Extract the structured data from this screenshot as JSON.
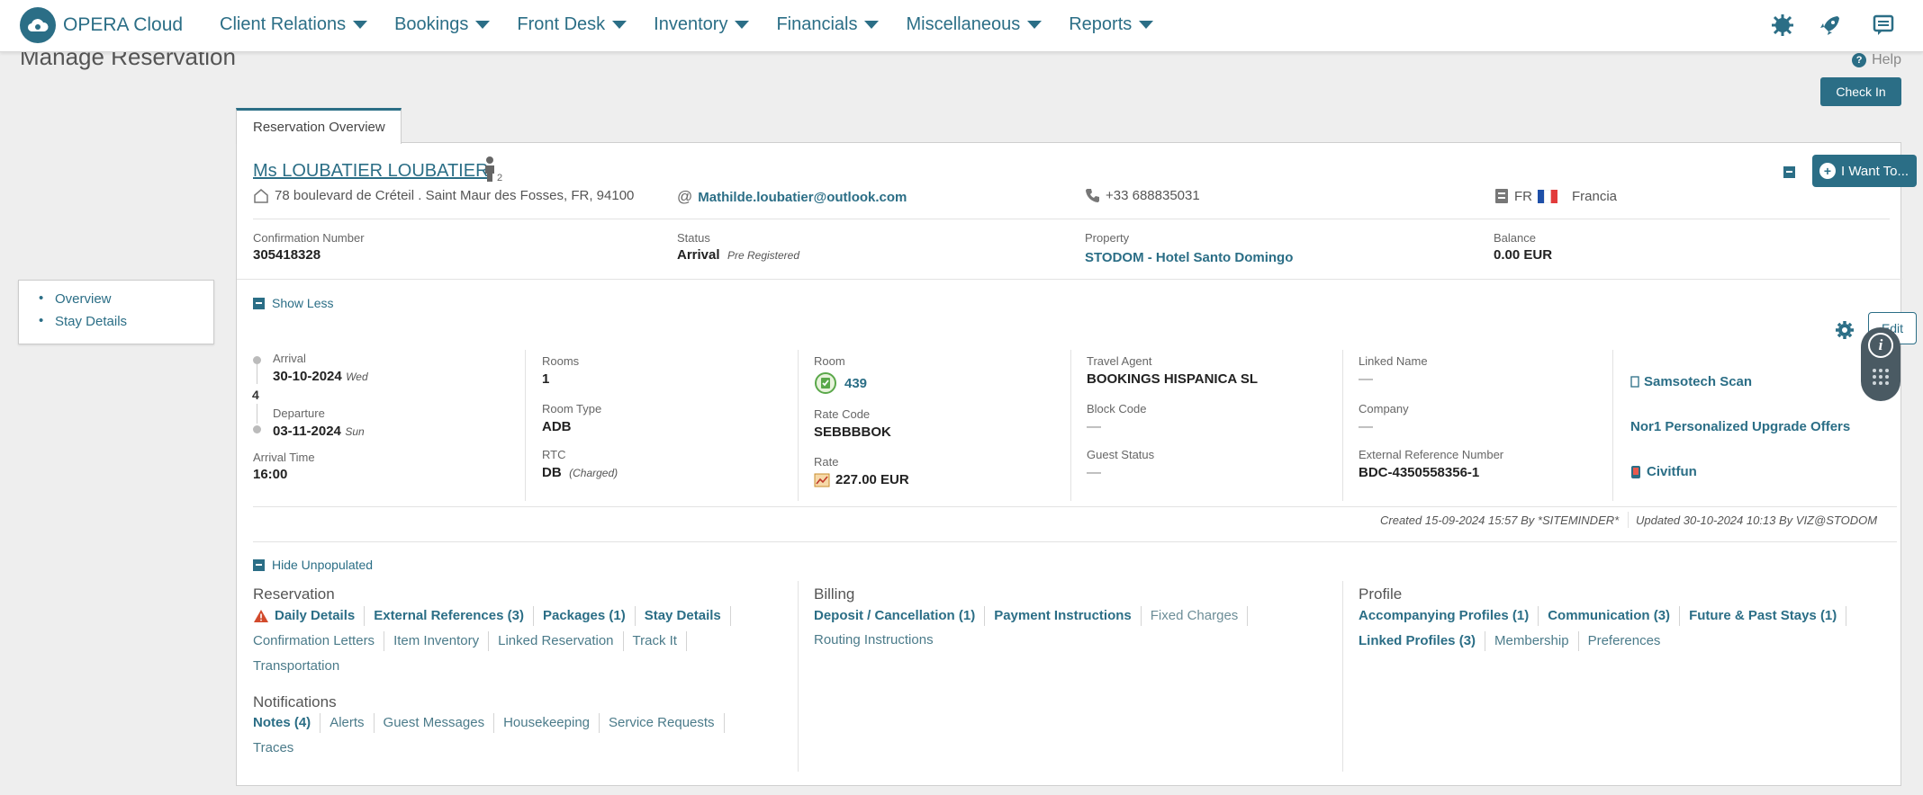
{
  "app": {
    "name": "OPERA Cloud"
  },
  "nav": [
    {
      "label": "Client Relations"
    },
    {
      "label": "Bookings"
    },
    {
      "label": "Front Desk"
    },
    {
      "label": "Inventory"
    },
    {
      "label": "Financials"
    },
    {
      "label": "Miscellaneous"
    },
    {
      "label": "Reports"
    }
  ],
  "page": {
    "title": "Manage Reservation",
    "help": "Help",
    "checkin": "Check In"
  },
  "anchors": [
    "Overview",
    "Stay Details"
  ],
  "tab": {
    "label": "Reservation Overview"
  },
  "guest": {
    "name": "Ms LOUBATIER LOUBATIER",
    "persons": "2",
    "address": "78 boulevard de Créteil . Saint Maur des Fosses, FR, 94100",
    "email": "Mathilde.loubatier@outlook.com",
    "phone": "+33 688835031",
    "country_code": "FR",
    "country": "Francia"
  },
  "want_button": "I Want To...",
  "summary": {
    "confirmation_label": "Confirmation Number",
    "confirmation": "305418328",
    "status_label": "Status",
    "status": "Arrival",
    "status_sub": "Pre Registered",
    "property_label": "Property",
    "property": "STODOM - Hotel Santo Domingo",
    "balance_label": "Balance",
    "balance": "0.00 EUR"
  },
  "show_less": "Show Less",
  "edit": "Edit",
  "stay": {
    "arrival_label": "Arrival",
    "arrival": "30-10-2024",
    "arrival_day": "Wed",
    "nights": "4",
    "departure_label": "Departure",
    "departure": "03-11-2024",
    "departure_day": "Sun",
    "arrival_time_label": "Arrival Time",
    "arrival_time": "16:00",
    "rooms_label": "Rooms",
    "rooms": "1",
    "room_type_label": "Room Type",
    "room_type": "ADB",
    "rtc_label": "RTC",
    "rtc": "DB",
    "rtc_sub": "(Charged)",
    "room_label": "Room",
    "room": "439",
    "rate_code_label": "Rate Code",
    "rate_code": "SEBBBBOK",
    "rate_label": "Rate",
    "rate": "227.00 EUR",
    "travel_agent_label": "Travel Agent",
    "travel_agent": "BOOKINGS HISPANICA SL",
    "block_code_label": "Block Code",
    "block_code": "—",
    "guest_status_label": "Guest Status",
    "guest_status": "—",
    "linked_name_label": "Linked Name",
    "linked_name": "—",
    "company_label": "Company",
    "company": "—",
    "ext_ref_label": "External Reference Number",
    "ext_ref": "BDC-4350558356-1",
    "ext_links": [
      "Samsotech Scan",
      "Nor1 Personalized Upgrade Offers",
      "Civitfun"
    ]
  },
  "created": "Created  15-09-2024 15:57  By  *SITEMINDER*",
  "updated": "Updated  30-10-2024 10:13  By  VIZ@STODOM",
  "hide_unpopulated": "Hide Unpopulated",
  "reservation_section": {
    "title": "Reservation",
    "row1": [
      "Daily Details",
      "External References (3)",
      "Packages (1)",
      "Stay Details"
    ],
    "row2": [
      "Confirmation Letters",
      "Item Inventory",
      "Linked Reservation",
      "Track It"
    ],
    "row3": [
      "Transportation"
    ]
  },
  "notifications_section": {
    "title": "Notifications",
    "row1": [
      "Notes (4)",
      "Alerts",
      "Guest Messages",
      "Housekeeping",
      "Service Requests"
    ],
    "row2": [
      "Traces"
    ]
  },
  "billing_section": {
    "title": "Billing",
    "row1": [
      "Deposit / Cancellation (1)",
      "Payment Instructions",
      "Fixed Charges"
    ],
    "row2": [
      "Routing Instructions"
    ]
  },
  "profile_section": {
    "title": "Profile",
    "row1": [
      "Accompanying Profiles (1)",
      "Communication (3)",
      "Future & Past Stays (1)"
    ],
    "row2": [
      "Linked Profiles (3)",
      "Membership",
      "Preferences"
    ]
  },
  "colors": {
    "accent": "#2b6e86",
    "background": "#eeeeee"
  }
}
